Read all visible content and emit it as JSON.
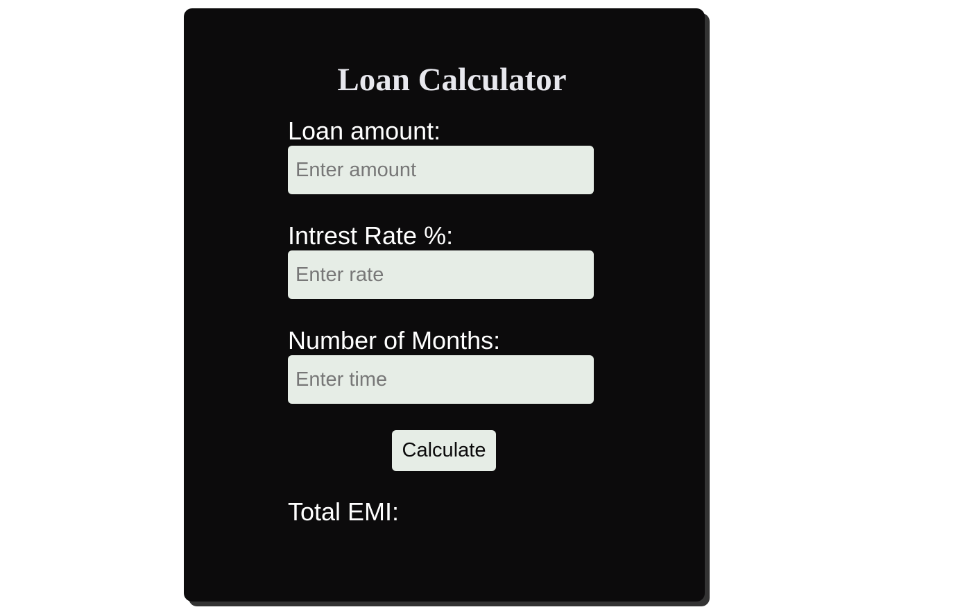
{
  "calculator": {
    "title": "Loan Calculator",
    "fields": [
      {
        "label": "Loan amount:",
        "value": "",
        "placeholder": "Enter amount"
      },
      {
        "label": "Intrest Rate %:",
        "value": "",
        "placeholder": "Enter rate"
      },
      {
        "label": "Number of Months:",
        "value": "",
        "placeholder": "Enter time"
      }
    ],
    "calculate_label": "Calculate",
    "result_label": "Total EMI:",
    "result_value": ""
  },
  "colors": {
    "card_background": "#0c0b0c",
    "card_shadow": "#333333",
    "input_background": "#e6ede6",
    "title_text": "#e8e8ee",
    "label_text": "#ffffff"
  }
}
